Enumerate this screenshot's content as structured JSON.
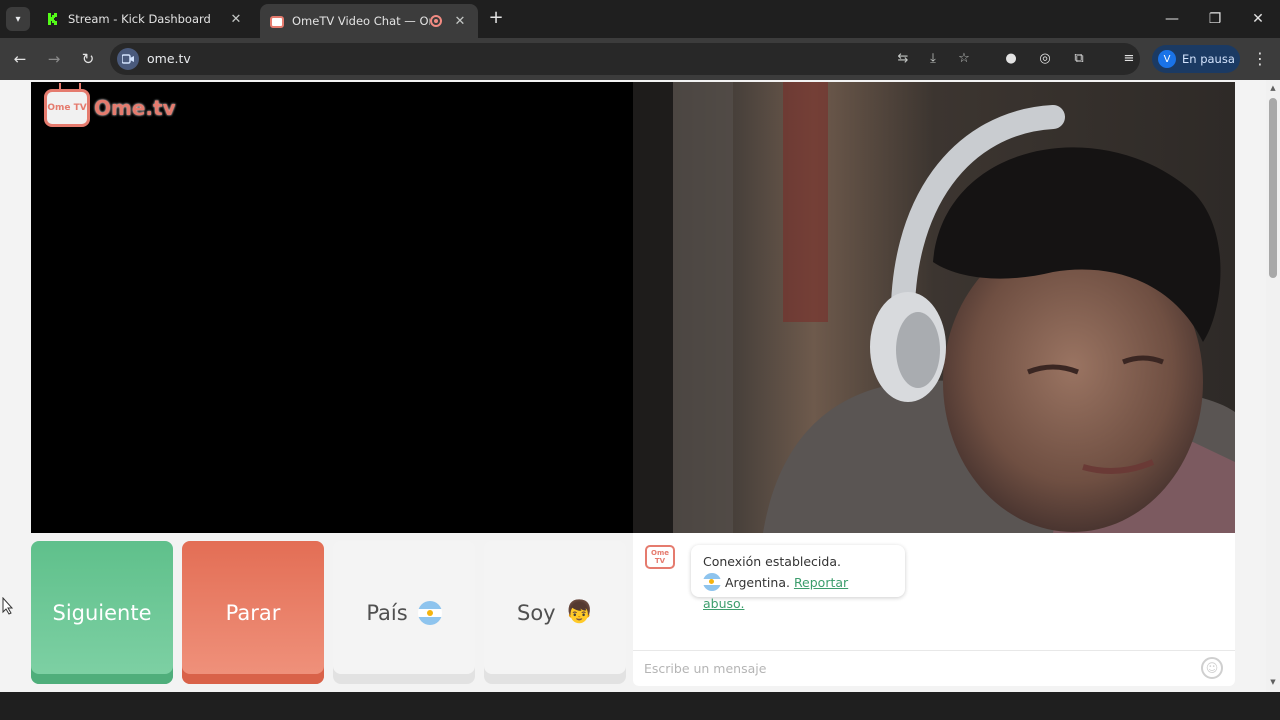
{
  "tabs": [
    {
      "title": "Stream - Kick Dashboard",
      "favicon": "kick-icon"
    },
    {
      "title": "OmeTV Video Chat — Ome",
      "favicon": "ometv-icon",
      "active": true
    }
  ],
  "toolbar": {
    "url": "ome.tv",
    "profile_initial": "V",
    "profile_label": "En pausa"
  },
  "logo": {
    "tv_text": "Ome TV",
    "brand": "Ome.tv"
  },
  "buttons": {
    "next": "Siguiente",
    "stop": "Parar",
    "country": "País",
    "gender": "Soy"
  },
  "chat": {
    "logo_text": "Ome TV",
    "connection": "Conexión establecida.",
    "country": "Argentina.",
    "report": "Reportar abuso.",
    "placeholder": "Escribe un mensaje"
  },
  "colors": {
    "next_button": "#6cc897",
    "stop_button": "#e8765d",
    "brand": "#e57b6e",
    "link": "#3c9d6c"
  }
}
